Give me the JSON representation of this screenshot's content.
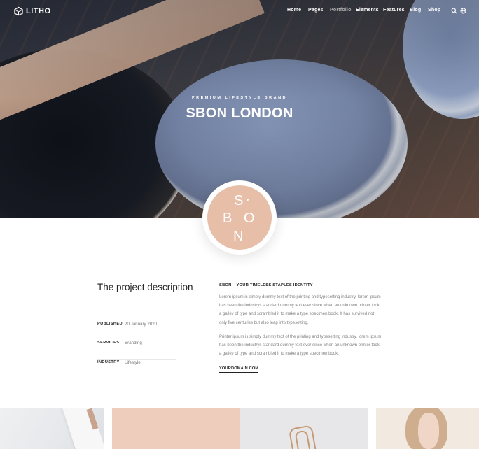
{
  "brand": {
    "name": "LITHO"
  },
  "nav": {
    "items": [
      {
        "label": "Home"
      },
      {
        "label": "Pages"
      },
      {
        "label": "Portfolio"
      },
      {
        "label": "Elements"
      },
      {
        "label": "Features"
      },
      {
        "label": "Blog"
      },
      {
        "label": "Shop"
      }
    ],
    "icons": [
      "search-icon",
      "globe-icon"
    ]
  },
  "hero": {
    "subtitle": "PREMIUM LIFESTYLE BRAND",
    "title": "SBON LONDON"
  },
  "badge": {
    "letters": [
      "S",
      "B",
      "O",
      "N"
    ],
    "color": "#e7bfa9"
  },
  "project": {
    "title": "The project description",
    "meta": [
      {
        "label": "PUBLISHED",
        "value": "20 January 2020"
      },
      {
        "label": "SERVICES",
        "value": "Branding"
      },
      {
        "label": "INDUSTRY",
        "value": "Lifestyle"
      }
    ],
    "heading": "SBON – YOUR TIMELESS STAPLES IDENTITY",
    "paragraphs": [
      "Lorem ipsum is simply dummy text of the printing and typesetting industry. lorem ipsum has been the industrys standard dummy text ever since when an unknown printer took a galley of type and scrambled it to make a type specimen book. It has survived not only five centuries but also leap into typesetting.",
      "Printer ipsum is simply dummy text of the printing and typesetting industry. lorem ipsum has been the industrys standard dummy text ever since when an unknown printer took a galley of type and scrambled it to make a type specimen book."
    ],
    "link": "YOURDOMAIN.COM"
  }
}
